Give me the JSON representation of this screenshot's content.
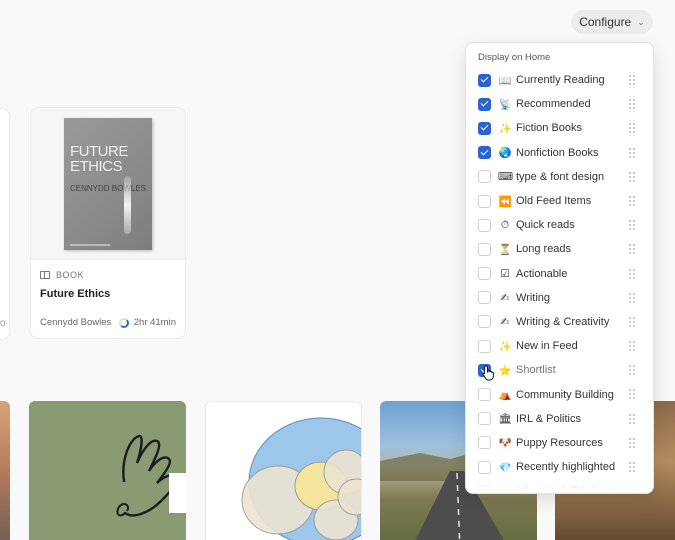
{
  "header": {
    "configure_label": "Configure"
  },
  "left_fragment": {
    "text": "o"
  },
  "book_card": {
    "cover_title": "FUTURE ETHICS",
    "cover_author": "CENNYDD BOWLES",
    "type_label": "BOOK",
    "title": "Future Ethics",
    "author": "Cennydd Bowles",
    "read_time": "2hr 41min"
  },
  "dropdown": {
    "heading": "Display on Home",
    "items": [
      {
        "emoji": "📖",
        "label": "Currently Reading",
        "checked": true
      },
      {
        "emoji": "📡",
        "label": "Recommended",
        "checked": true
      },
      {
        "emoji": "✨",
        "label": "Fiction Books",
        "checked": true
      },
      {
        "emoji": "🌏",
        "label": "Nonfiction Books",
        "checked": true
      },
      {
        "emoji": "⌨",
        "label": "type & font design",
        "checked": false
      },
      {
        "emoji": "⏪",
        "label": "Old Feed Items",
        "checked": false
      },
      {
        "emoji": "⏱",
        "label": "Quick reads",
        "checked": false
      },
      {
        "emoji": "⏳",
        "label": "Long reads",
        "checked": false
      },
      {
        "emoji": "☑",
        "label": "Actionable",
        "checked": false
      },
      {
        "emoji": "✍",
        "label": "Writing",
        "checked": false
      },
      {
        "emoji": "✍",
        "label": "Writing & Creativity",
        "checked": false
      },
      {
        "emoji": "✨",
        "label": "New in Feed",
        "checked": false
      },
      {
        "emoji": "⭐",
        "label": "Shortlist",
        "checked": true
      },
      {
        "emoji": "⛺",
        "label": "Community Building",
        "checked": false
      },
      {
        "emoji": "🏛",
        "label": "IRL & Politics",
        "checked": false
      },
      {
        "emoji": "🐶",
        "label": "Puppy Resources",
        "checked": false
      },
      {
        "emoji": "💎",
        "label": "Recently highlighted",
        "checked": false
      },
      {
        "emoji": "🫧",
        "label": "Lifestyle & Thinking",
        "checked": false
      }
    ]
  },
  "colors": {
    "accent": "#2c63d2",
    "hand_bg": "#8a9a72"
  },
  "icons": {
    "cursor": "pointer-hand-icon",
    "book": "book-icon",
    "grip": "drag-handle-icon"
  }
}
